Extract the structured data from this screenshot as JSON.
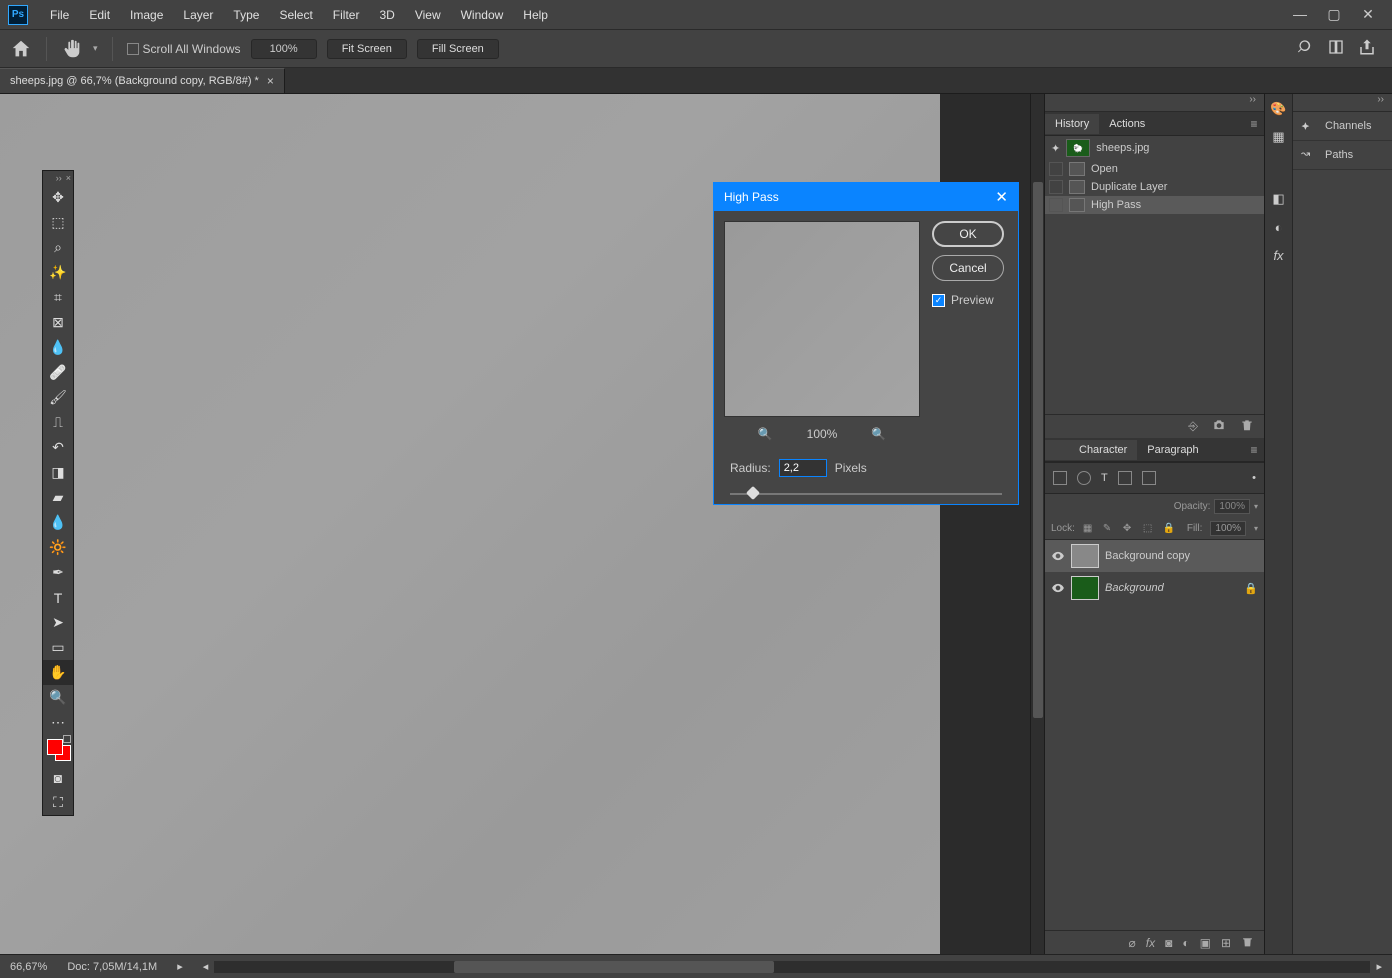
{
  "menu": {
    "items": [
      "File",
      "Edit",
      "Image",
      "Layer",
      "Type",
      "Select",
      "Filter",
      "3D",
      "View",
      "Window",
      "Help"
    ]
  },
  "options": {
    "scroll_all": "Scroll All Windows",
    "zoom": "100%",
    "fit": "Fit Screen",
    "fill": "Fill Screen"
  },
  "document": {
    "tab_title": "sheeps.jpg @ 66,7% (Background copy, RGB/8#) *"
  },
  "history_panel": {
    "tabs": [
      "History",
      "Actions"
    ],
    "source": "sheeps.jpg",
    "steps": [
      "Open",
      "Duplicate Layer",
      "High Pass"
    ]
  },
  "char_panel": {
    "tabs": [
      "Character",
      "Paragraph"
    ]
  },
  "layers": {
    "opacity_label": "Opacity:",
    "opacity_value": "100%",
    "lock_label": "Lock:",
    "fill_label": "Fill:",
    "fill_value": "100%",
    "items": [
      {
        "name": "Background copy",
        "locked": false
      },
      {
        "name": "Background",
        "locked": true
      }
    ]
  },
  "far_panels": {
    "channels": "Channels",
    "paths": "Paths"
  },
  "dialog": {
    "title": "High Pass",
    "ok": "OK",
    "cancel": "Cancel",
    "preview": "Preview",
    "zoom": "100%",
    "radius_label": "Radius:",
    "radius_value": "2,2",
    "radius_unit": "Pixels"
  },
  "status": {
    "zoom": "66,67%",
    "doc_info": "Doc: 7,05M/14,1M"
  },
  "colors": {
    "accent": "#0a84ff",
    "foreground": "#ff0000"
  }
}
